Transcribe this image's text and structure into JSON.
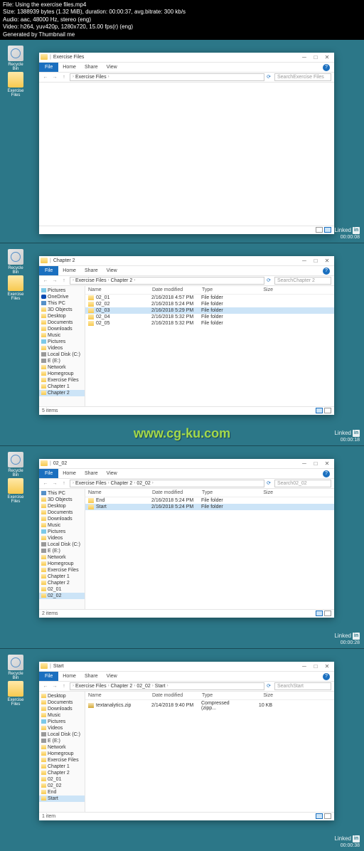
{
  "header": {
    "file": "File: Using the exercise files.mp4",
    "size": "Size: 1388939 bytes (1.32 MiB), duration: 00:00:37, avg.bitrate: 300 kb/s",
    "audio": "Audio: aac, 48000 Hz, stereo (eng)",
    "video": "Video: h264, yuv420p, 1280x720, 15.00 fps(r) (eng)",
    "gen": "Generated by Thumbnail me"
  },
  "desktop": {
    "recycle": "Recycle Bin",
    "exfiles": "Exercise Files"
  },
  "watermark_site": "www.cg-ku.com",
  "linkedin_label": "Linked",
  "linkedin_in": "in",
  "timecodes": [
    "00:00:08",
    "00:00:18",
    "00:00:28",
    "00:00:38"
  ],
  "ribbon": {
    "file": "File",
    "home": "Home",
    "share": "Share",
    "view": "View"
  },
  "columns": {
    "name": "Name",
    "date": "Date modified",
    "type": "Type",
    "size": "Size"
  },
  "search_prefix": "Search ",
  "shot1": {
    "title": "Exercise Files",
    "crumbs": [
      "Exercise Files"
    ],
    "search": "Exercise Files"
  },
  "shot2": {
    "title": "Chapter 2",
    "crumbs": [
      "Exercise Files",
      "Chapter 2"
    ],
    "search": "Chapter 2",
    "nav": [
      "Pictures",
      "OneDrive",
      "This PC",
      "3D Objects",
      "Desktop",
      "Documents",
      "Downloads",
      "Music",
      "Pictures",
      "Videos",
      "Local Disk (C:)",
      "E (E:)",
      "Network",
      "Homegroup",
      "Exercise Files",
      "Chapter 1",
      "Chapter 2"
    ],
    "rows": [
      {
        "n": "02_01",
        "d": "2/16/2018 4:57 PM",
        "t": "File folder"
      },
      {
        "n": "02_02",
        "d": "2/16/2018 5:24 PM",
        "t": "File folder"
      },
      {
        "n": "02_03",
        "d": "2/16/2018 5:29 PM",
        "t": "File folder"
      },
      {
        "n": "02_04",
        "d": "2/16/2018 5:32 PM",
        "t": "File folder"
      },
      {
        "n": "02_05",
        "d": "2/16/2018 5:32 PM",
        "t": "File folder"
      }
    ],
    "status": "5 items"
  },
  "shot3": {
    "title": "02_02",
    "crumbs": [
      "Exercise Files",
      "Chapter 2",
      "02_02"
    ],
    "search": "02_02",
    "nav": [
      "This PC",
      "3D Objects",
      "Desktop",
      "Documents",
      "Downloads",
      "Music",
      "Pictures",
      "Videos",
      "Local Disk (C:)",
      "E (E:)",
      "Network",
      "Homegroup",
      "Exercise Files",
      "Chapter 1",
      "Chapter 2",
      "02_01",
      "02_02"
    ],
    "rows": [
      {
        "n": "End",
        "d": "2/16/2018 5:24 PM",
        "t": "File folder"
      },
      {
        "n": "Start",
        "d": "2/16/2018 5:24 PM",
        "t": "File folder"
      }
    ],
    "status": "2 items"
  },
  "shot4": {
    "title": "Start",
    "crumbs": [
      "Exercise Files",
      "Chapter 2",
      "02_02",
      "Start"
    ],
    "search": "Start",
    "nav": [
      "Desktop",
      "Documents",
      "Downloads",
      "Music",
      "Pictures",
      "Videos",
      "Local Disk (C:)",
      "E (E:)",
      "Network",
      "Homegroup",
      "Exercise Files",
      "Chapter 1",
      "Chapter 2",
      "02_01",
      "02_02",
      "End",
      "Start"
    ],
    "rows": [
      {
        "n": "textanalytics.zip",
        "d": "2/14/2018 9:40 PM",
        "t": "Compressed (zipp...",
        "s": "10 KB"
      }
    ],
    "status": "1 item"
  }
}
